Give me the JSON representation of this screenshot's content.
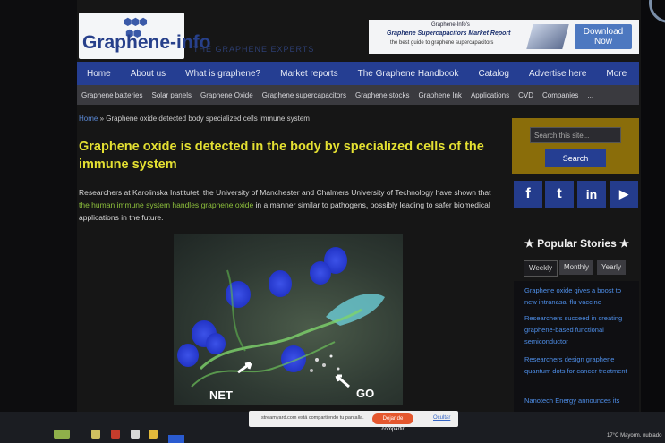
{
  "site": {
    "logo_text": "Graphene-info",
    "tagline": "THE GRAPHENE EXPERTS"
  },
  "ad": {
    "line1": "Graphene-Info's",
    "line2": "Graphene Supercapacitors Market Report",
    "line3": "the best guide to graphene supercapacitors",
    "cta": "Download Now"
  },
  "nav": [
    "Home",
    "About us",
    "What is graphene?",
    "Market reports",
    "The Graphene Handbook",
    "Catalog",
    "Advertise here",
    "More"
  ],
  "subnav": [
    "Graphene batteries",
    "Solar panels",
    "Graphene Oxide",
    "Graphene supercapacitors",
    "Graphene stocks",
    "Graphene Ink",
    "Applications",
    "CVD",
    "Companies",
    "..."
  ],
  "breadcrumb": {
    "home": "Home",
    "separator": " » ",
    "current": "Graphene oxide detected body specialized cells immune system"
  },
  "article": {
    "title": "Graphene oxide is detected in the body by specialized cells of the immune system",
    "body_1": "Researchers at Karolinska Institutet, the University of Manchester and Chalmers University of Technology have shown that ",
    "link_1": "the human immune system handles",
    "body_2": " ",
    "link_2": "graphene oxide",
    "body_3": " in a manner similar to pathogens, possibly leading to safer biomedical applications in the future.",
    "figure_label_1": "NET",
    "figure_label_2": "GO"
  },
  "sidebar": {
    "search_placeholder": "Search this site...",
    "search_button": "Search",
    "social": [
      "f",
      "t",
      "in",
      "▶"
    ],
    "popular_title": "★ Popular Stories ★",
    "tabs": [
      "Weekly",
      "Monthly",
      "Yearly"
    ],
    "stories": [
      "Graphene oxide gives a boost to new intranasal flu vaccine",
      "Researchers succeed in creating graphene-based functional semiconductor",
      "Researchers design graphene quantum dots for cancer treatment",
      "Nanotech Energy announces its"
    ]
  },
  "notification": {
    "message": "streamyard.com está compartiendo tu pantalla.",
    "stop": "Dejar de compartir",
    "hide": "Ocultar"
  },
  "tray": {
    "temp": "17°C",
    "weather": "Mayorm. nublado"
  },
  "colors": {
    "nav": "#253e92",
    "headline": "#e4e032",
    "link_green": "#8ec13c",
    "story_link": "#4e8ee8",
    "search_box": "#8a6d0a"
  }
}
